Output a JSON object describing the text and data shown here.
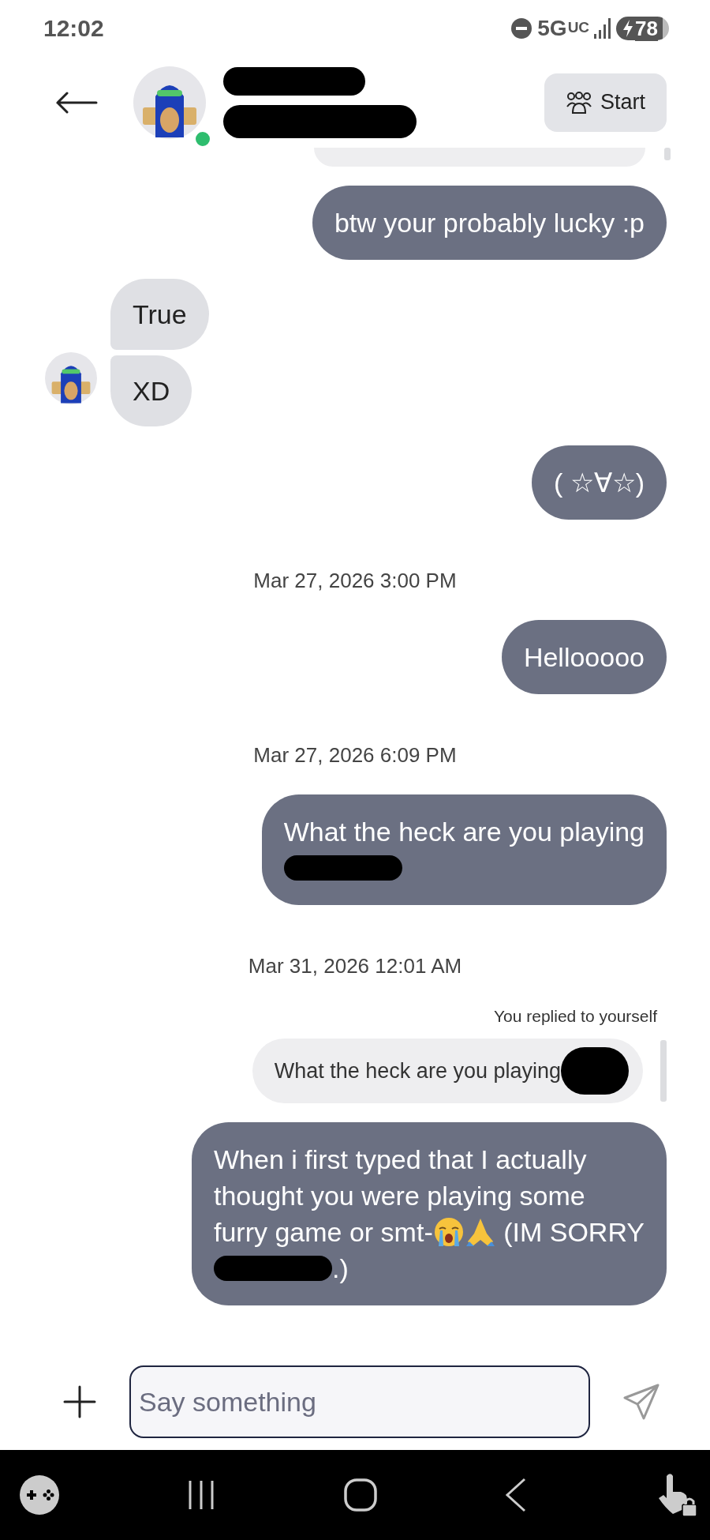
{
  "status_bar": {
    "time": "12:02",
    "network": "5G",
    "network_suffix": "UC",
    "battery": "78"
  },
  "header": {
    "online": true,
    "start_button": "Start"
  },
  "messages": [
    {
      "kind": "cut"
    },
    {
      "kind": "sent",
      "lines": [
        [
          {
            "kind": "text",
            "text": "btw your probably lucky :p"
          }
        ]
      ]
    },
    {
      "kind": "received",
      "bubbles": [
        "True",
        "XD"
      ]
    },
    {
      "kind": "sent",
      "lines": [
        [
          {
            "kind": "text",
            "text": "( ☆∀☆)"
          }
        ]
      ]
    },
    {
      "kind": "date",
      "text": "Mar 27, 2026 3:00 PM"
    },
    {
      "kind": "sent",
      "lines": [
        [
          {
            "kind": "text",
            "text": "Hellooooo"
          }
        ]
      ]
    },
    {
      "kind": "date",
      "text": "Mar 27, 2026 6:09 PM"
    },
    {
      "kind": "sent",
      "lines": [
        [
          {
            "kind": "text",
            "text": "What the heck are you playing"
          }
        ],
        [
          {
            "kind": "redacted"
          }
        ]
      ]
    },
    {
      "kind": "date",
      "text": "Mar 31, 2026 12:01 AM"
    },
    {
      "kind": "reply_note",
      "text": "You replied to yourself"
    },
    {
      "kind": "reply_quote",
      "text": "What the heck are you playing"
    },
    {
      "kind": "sent",
      "lines": [
        [
          {
            "kind": "text",
            "text": "When i first typed that I actually"
          }
        ],
        [
          {
            "kind": "text",
            "text": "thought you were playing some"
          }
        ],
        [
          {
            "kind": "text",
            "text": "furry game or smt-"
          },
          {
            "kind": "crying_emoji"
          },
          {
            "kind": "praying_emoji"
          },
          {
            "kind": "text",
            "text": " (IM SORRY"
          }
        ],
        [
          {
            "kind": "redacted"
          },
          {
            "kind": "text",
            "text": ".)"
          }
        ]
      ]
    }
  ],
  "composer": {
    "placeholder": "Say something"
  }
}
